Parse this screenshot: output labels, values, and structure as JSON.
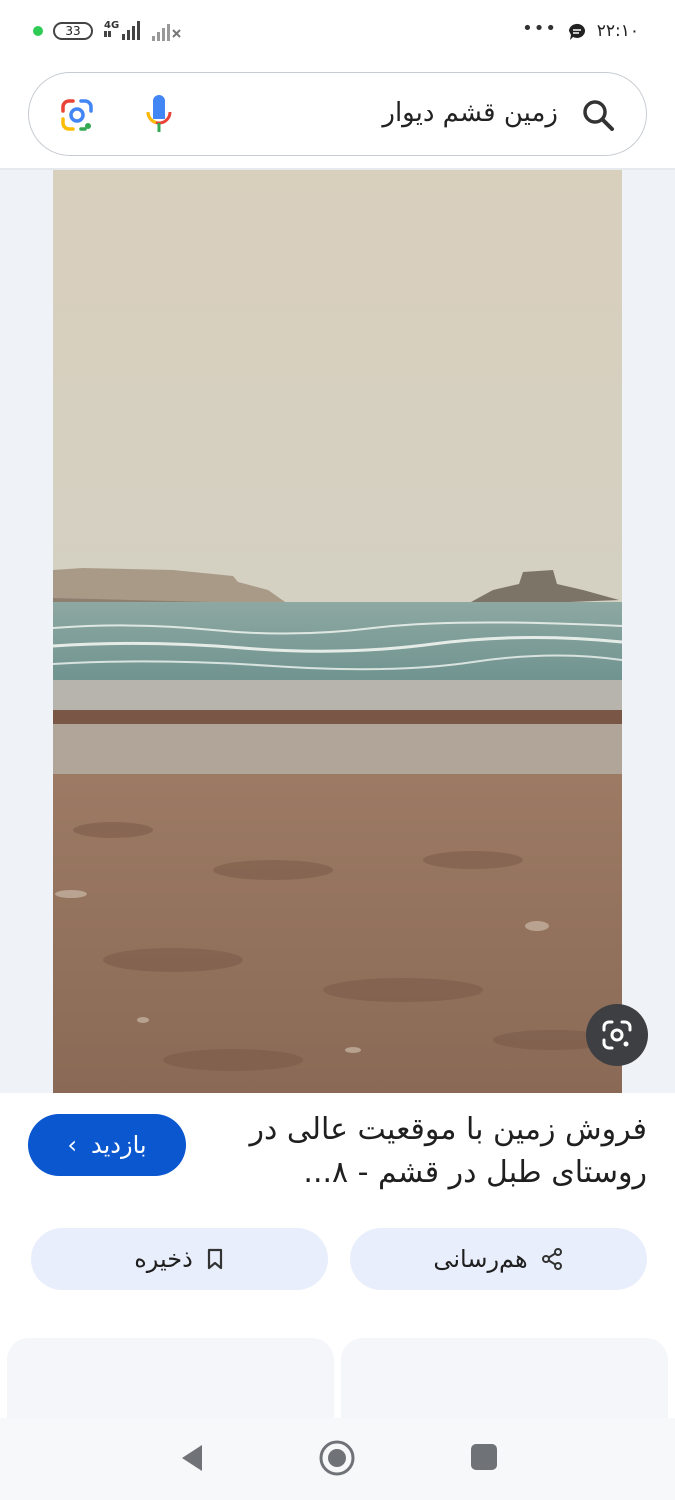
{
  "status_bar": {
    "battery": "33",
    "network": "4G",
    "time": "۲۲:۱۰",
    "more": "•••"
  },
  "search": {
    "query": "زمین قشم دیوار",
    "icons": [
      "search-icon",
      "mic-icon",
      "google-lens-icon"
    ]
  },
  "result": {
    "title": "فروش زمین با موقعیت عالی در روستای طبل در قشم - ۸...",
    "visit_label": "بازدید",
    "share_label": "هم‌رسانی",
    "save_label": "ذخیره"
  },
  "colors": {
    "accent": "#0b57d0",
    "pill_bg": "#e8eefb",
    "nav_bg": "#f7f8fa"
  },
  "nav": {
    "icons": [
      "back-icon",
      "home-icon",
      "recents-icon"
    ]
  }
}
